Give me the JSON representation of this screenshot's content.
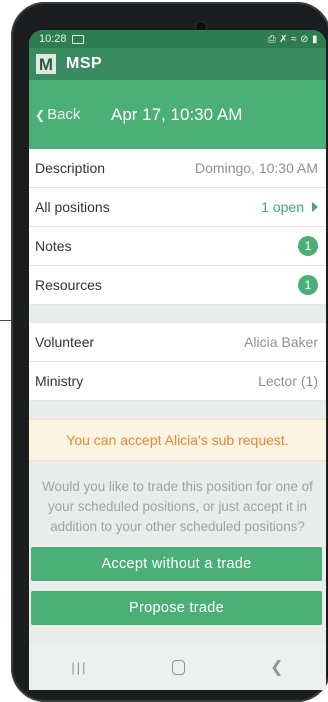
{
  "status_bar": {
    "time": "10:28",
    "image_icon": "image-icon",
    "right_icons": [
      "nfc-icon",
      "mute-icon",
      "wifi-icon",
      "do-not-disturb-icon",
      "battery-icon"
    ]
  },
  "app": {
    "logo_letter": "M",
    "title": "MSP"
  },
  "nav": {
    "back_label": "Back",
    "title": "Apr 17, 10:30 AM"
  },
  "details": [
    {
      "label": "Description",
      "value": "Domingo, 10:30 AM"
    },
    {
      "label": "All positions",
      "value": "1 open"
    },
    {
      "label": "Notes",
      "badge": "1"
    },
    {
      "label": "Resources",
      "badge": "1"
    }
  ],
  "assignment": [
    {
      "label": "Volunteer",
      "value": "Alicia Baker"
    },
    {
      "label": "Ministry",
      "value": "Lector (1)"
    }
  ],
  "notice": "You can accept Alicia's sub request.",
  "question": "Would you like to trade this position for one of your scheduled positions, or just accept it in addition to your other scheduled positions?",
  "buttons": {
    "accept": "Accept without a trade",
    "propose": "Propose trade"
  },
  "colors": {
    "status_bar": "#2f7b52",
    "app_bar": "#3a8c60",
    "nav_bar": "#4caf78",
    "accent": "#4caf78",
    "notice_text": "#e08a2e",
    "notice_bg": "#fdf4e3"
  }
}
